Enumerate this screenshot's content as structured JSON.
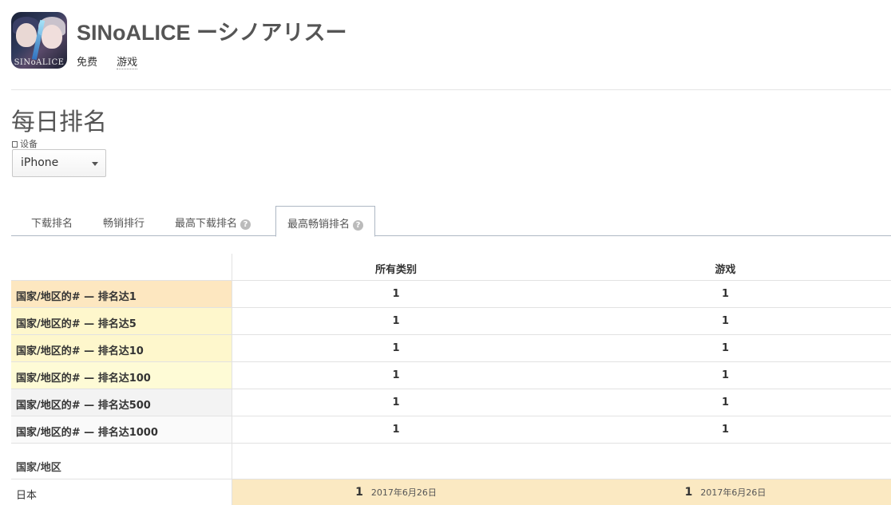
{
  "app": {
    "title": "SINoALICE ーシノアリスー",
    "icon_logo": "SINoALICE",
    "price": "免费",
    "category": "游戏"
  },
  "section_title": "每日排名",
  "device": {
    "label": "设备",
    "selected": "iPhone",
    "icon": "device-icon"
  },
  "tabs": [
    {
      "label": "下载排名"
    },
    {
      "label": "畅销排行"
    },
    {
      "label": "最高下载排名"
    },
    {
      "label": "最高畅销排名",
      "active": true
    }
  ],
  "table": {
    "columns": [
      "所有类别",
      "游戏"
    ],
    "rows": [
      {
        "label": "国家/地区的# — 排名达1",
        "all": "1",
        "games": "1",
        "bg": "#fde7c0"
      },
      {
        "label": "国家/地区的# — 排名达5",
        "all": "1",
        "games": "1",
        "bg": "#fef7cc"
      },
      {
        "label": "国家/地区的# — 排名达10",
        "all": "1",
        "games": "1",
        "bg": "#fef7cc"
      },
      {
        "label": "国家/地区的# — 排名达100",
        "all": "1",
        "games": "1",
        "bg": "#fefbd6"
      },
      {
        "label": "国家/地区的# — 排名达500",
        "all": "1",
        "games": "1",
        "bg": "#f3f3f3"
      },
      {
        "label": "国家/地区的# — 排名达1000",
        "all": "1",
        "games": "1",
        "bg": "#fafafa"
      }
    ]
  },
  "countries": {
    "header": "国家/地区",
    "rows": [
      {
        "name": "日本",
        "all_rank": "1",
        "all_date": "2017年6月26日",
        "games_rank": "1",
        "games_date": "2017年6月26日"
      }
    ]
  }
}
